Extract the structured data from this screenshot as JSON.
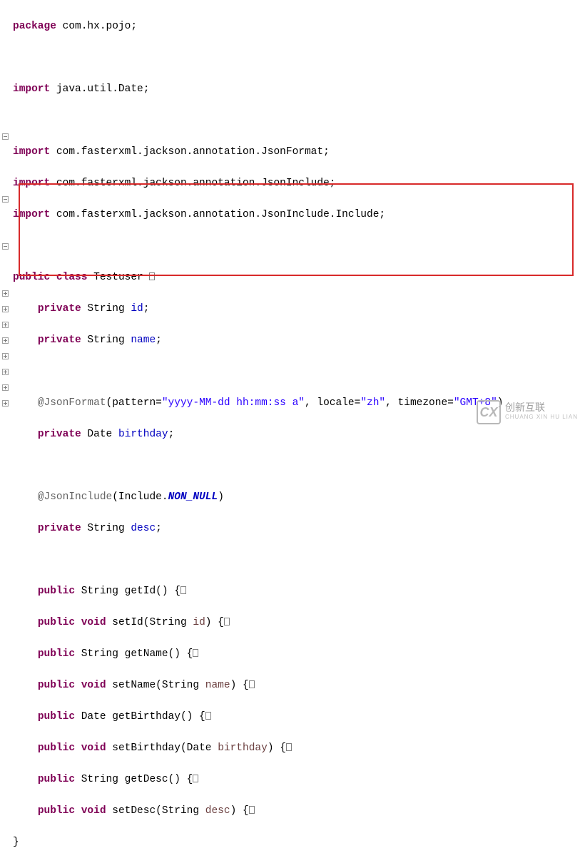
{
  "code": {
    "pkg_kw": "package",
    "pkg_name": " com.hx.pojo;",
    "import_kw": "import",
    "imp1": " java.util.Date;",
    "imp2": " com.fasterxml.jackson.annotation.JsonFormat;",
    "imp3": " com.fasterxml.jackson.annotation.JsonInclude;",
    "imp4": " com.fasterxml.jackson.annotation.JsonInclude.Include;",
    "public_kw": "public",
    "class_kw": "class",
    "private_kw": "private",
    "void_kw": "void",
    "class_name": " Testuser ",
    "lbrace": "{",
    "rbrace": "}",
    "string_t": " String ",
    "date_t": " Date ",
    "id_f": "id",
    "name_f": "name",
    "birthday_f": "birthday",
    "desc_f": "desc",
    "semi": ";",
    "ann_jsonformat": "@JsonFormat",
    "jf_open": "(pattern=",
    "jf_pattern": "\"yyyy-MM-dd hh:mm:ss a\"",
    "jf_mid1": ", locale=",
    "jf_locale": "\"zh\"",
    "jf_mid2": ", timezone=",
    "jf_tz": "\"GMT+8\"",
    "jf_close": ")",
    "ann_jsoninclude": "@JsonInclude",
    "ji_open": "(Include.",
    "ji_const": "NON_NULL",
    "ji_close": ")",
    "m_getId": " String getId() {",
    "m_setId_a": " setId(String ",
    "m_setId_b": ") {",
    "m_getName": " String getName() {",
    "m_setName_a": " setName(String ",
    "m_setName_b": ") {",
    "m_getBirthday": " Date getBirthday() {",
    "m_setBirthday_a": " setBirthday(Date ",
    "m_setBirthday_b": ") {",
    "m_getDesc": " String getDesc() {",
    "m_setDesc_a": " setDesc(String ",
    "m_setDesc_b": ") {"
  },
  "watermark": {
    "logo": "CX",
    "cn": "创新互联",
    "en": "CHUANG XIN HU LIAN"
  }
}
